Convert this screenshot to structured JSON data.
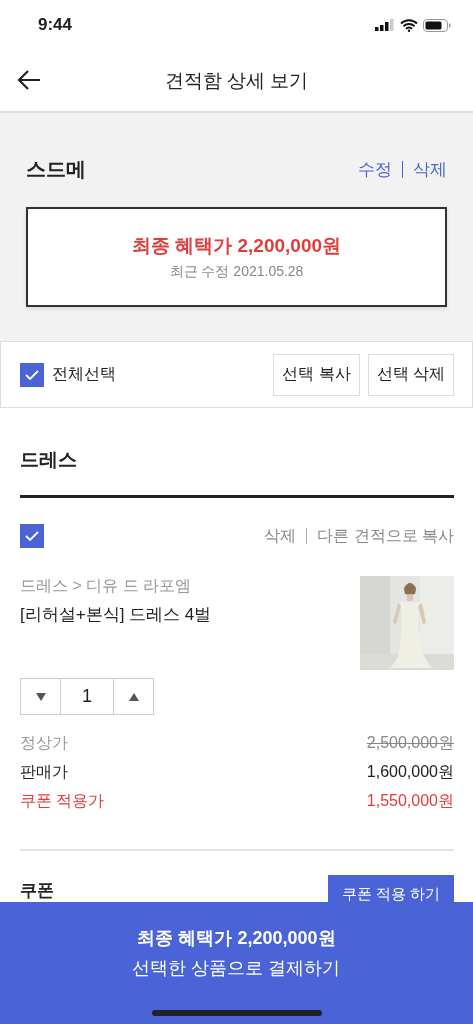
{
  "status_bar": {
    "time": "9:44"
  },
  "header": {
    "title": "견적함 상세 보기"
  },
  "quote": {
    "name": "스드메",
    "actions": [
      "수정",
      "삭제"
    ],
    "total": "최종 혜택가 2,200,000원",
    "updated": "최근 수정 2021.05.28"
  },
  "select_bar": {
    "select_all": {
      "label": "전체선택",
      "checked": true
    },
    "buttons": [
      "선택 복사",
      "선택 삭제"
    ]
  },
  "sections": [
    {
      "title": "드레스",
      "items": [
        {
          "checked": true,
          "actions": [
            "삭제",
            "다른 견적으로 복사"
          ],
          "category": "드레스 > 디유 드 라포엠",
          "name": "[리허설+본식] 드레스 4벌",
          "image": {
            "kind": "picture"
          },
          "quantity": "1",
          "prices": [
            {
              "label": "정상가",
              "value": "2,500,000원",
              "kind": "original"
            },
            {
              "label": "판매가",
              "value": "1,600,000원",
              "kind": "sale"
            },
            {
              "label": "쿠폰 적용가",
              "value": "1,550,000원",
              "kind": "coupon"
            }
          ]
        }
      ]
    }
  ],
  "coupon": {
    "label": "쿠폰",
    "button": "쿠폰 적용 하기"
  },
  "checkout": {
    "total": "최종 혜택가 2,200,000원",
    "action": "선택한 상품으로 결제하기"
  }
}
